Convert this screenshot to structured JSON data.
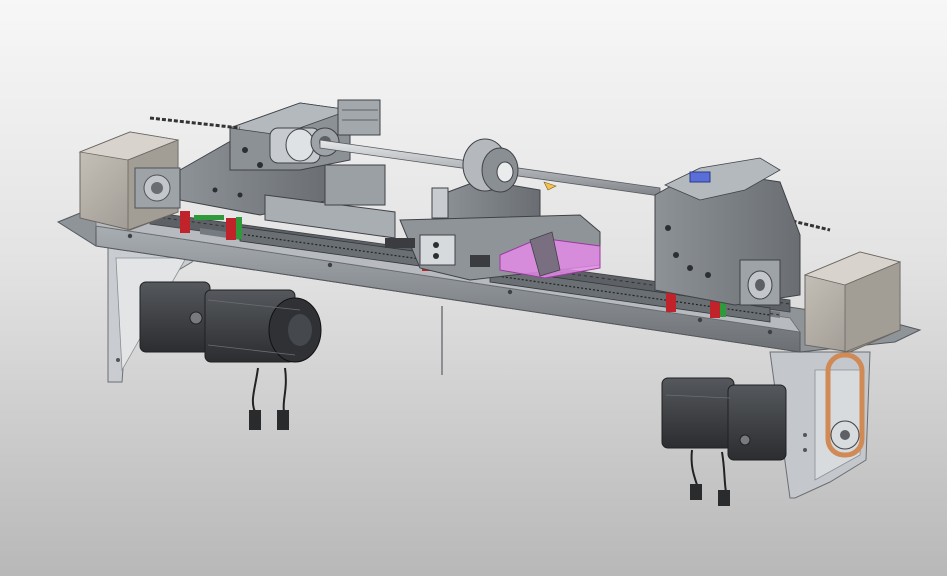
{
  "view": {
    "background_top": "#f7f7f7",
    "background_bottom": "#b8b8b8"
  },
  "colors": {
    "steel_light": "#b9bec3",
    "steel_mid": "#8c9196",
    "steel_dark": "#5a5e63",
    "block_face": "#7d8287",
    "rail_green": "#2f9a3a",
    "rail_red": "#c0242a",
    "copper": "#d08a55",
    "workpiece_pink": "#e38be6",
    "motor_black": "#3a3c3f",
    "cover_tan": "#b3aea6"
  },
  "parts": [
    "base-plate",
    "left-cover-box",
    "right-cover-box",
    "left-carriage",
    "right-carriage",
    "center-chuck",
    "ball-screw",
    "linear-rails",
    "left-servo-motor",
    "right-servo-motor",
    "belt-drive",
    "workpiece"
  ]
}
